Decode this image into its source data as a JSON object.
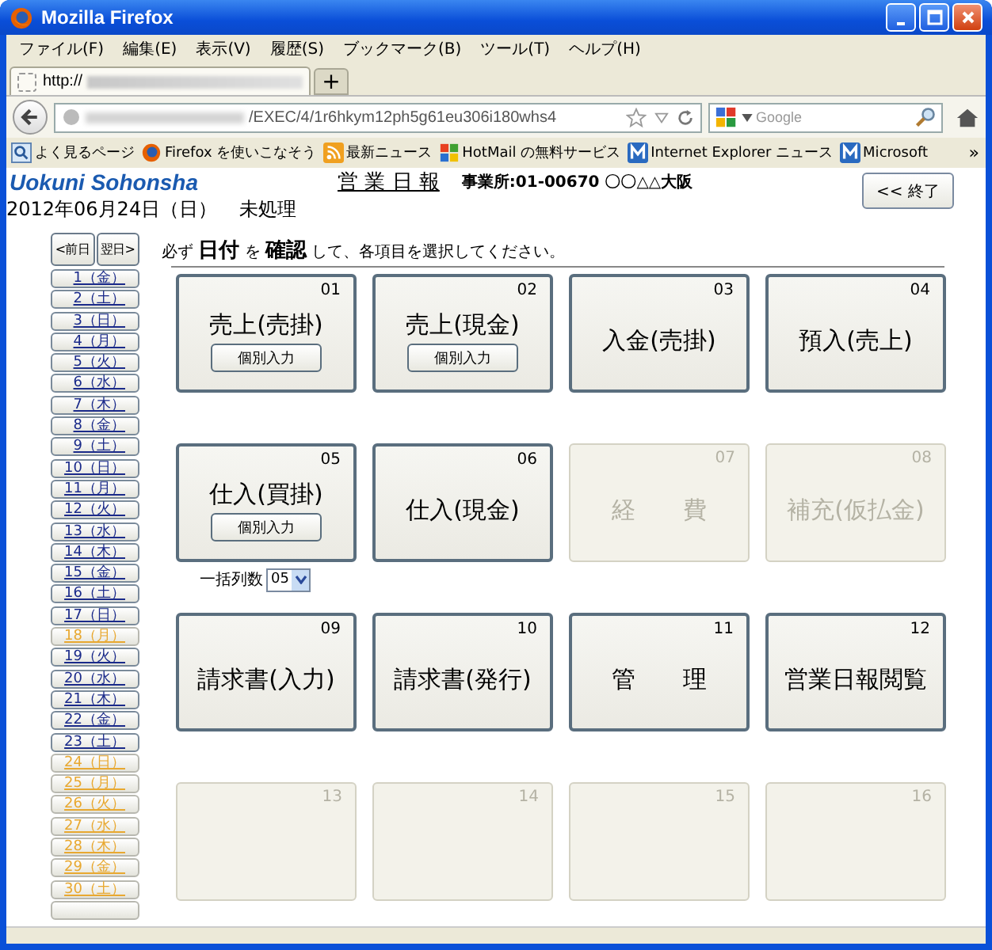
{
  "window": {
    "title": "Mozilla Firefox"
  },
  "menu": [
    "ファイル(F)",
    "編集(E)",
    "表示(V)",
    "履歴(S)",
    "ブックマーク(B)",
    "ツール(T)",
    "ヘルプ(H)"
  ],
  "tabs": [
    {
      "label": "http://",
      "selected": true
    }
  ],
  "new_tab": "+",
  "address_bar": {
    "url": "/EXEC/4/1r6hkym12ph5g61eu306i180whs4"
  },
  "search": {
    "placeholder": "Google"
  },
  "bookmarks": [
    {
      "label": "よく見るページ",
      "kind": "magnifier"
    },
    {
      "label": "Firefox を使いこなそう",
      "kind": "firefox"
    },
    {
      "label": "最新ニュース",
      "kind": "rss"
    },
    {
      "label": "HotMail の無料サービス",
      "kind": "windows"
    },
    {
      "label": "Internet Explorer ニュース",
      "kind": "msn"
    },
    {
      "label": "Microsoft",
      "kind": "msn"
    }
  ],
  "bookmarks_more": "»",
  "page": {
    "brand": "Uokuni Sohonsha",
    "title": "営 業 日 報",
    "office": "事業所:01-00670 〇〇△△大阪",
    "exit_button": "<< 終了",
    "date": "2012年06月24日（日）",
    "status": "未処理",
    "prev_day": "<前日",
    "next_day": "翌日>",
    "instruction": "必ず **日付** を **確認** して、各項目を選択してください。"
  },
  "days": [
    {
      "label": "1（金）",
      "disabled": false
    },
    {
      "label": "2（土）",
      "disabled": false
    },
    {
      "label": "3（日）",
      "disabled": false
    },
    {
      "label": "4（月）",
      "disabled": false
    },
    {
      "label": "5（火）",
      "disabled": false
    },
    {
      "label": "6（水）",
      "disabled": false
    },
    {
      "label": "7（木）",
      "disabled": false
    },
    {
      "label": "8（金）",
      "disabled": false
    },
    {
      "label": "9（土）",
      "disabled": false
    },
    {
      "label": "10（日）",
      "disabled": false
    },
    {
      "label": "11（月）",
      "disabled": false
    },
    {
      "label": "12（火）",
      "disabled": false
    },
    {
      "label": "13（水）",
      "disabled": false
    },
    {
      "label": "14（木）",
      "disabled": false
    },
    {
      "label": "15（金）",
      "disabled": false
    },
    {
      "label": "16（土）",
      "disabled": false
    },
    {
      "label": "17（日）",
      "disabled": false
    },
    {
      "label": "18（月）",
      "disabled": true
    },
    {
      "label": "19（火）",
      "disabled": false
    },
    {
      "label": "20（水）",
      "disabled": false
    },
    {
      "label": "21（木）",
      "disabled": false
    },
    {
      "label": "22（金）",
      "disabled": false
    },
    {
      "label": "23（土）",
      "disabled": false
    },
    {
      "label": "24（日）",
      "disabled": true
    },
    {
      "label": "25（月）",
      "disabled": true
    },
    {
      "label": "26（火）",
      "disabled": true
    },
    {
      "label": "27（水）",
      "disabled": true
    },
    {
      "label": "28（木）",
      "disabled": true
    },
    {
      "label": "29（金）",
      "disabled": true
    },
    {
      "label": "30（土）",
      "disabled": true
    }
  ],
  "tiles": [
    {
      "number": "01",
      "label": "売上(売掛)",
      "disabled": false,
      "sub_button": "個別入力"
    },
    {
      "number": "02",
      "label": "売上(現金)",
      "disabled": false,
      "sub_button": "個別入力"
    },
    {
      "number": "03",
      "label": "入金(売掛)",
      "disabled": false
    },
    {
      "number": "04",
      "label": "預入(売上)",
      "disabled": false
    },
    {
      "number": "05",
      "label": "仕入(買掛)",
      "disabled": false,
      "sub_button": "個別入力"
    },
    {
      "number": "06",
      "label": "仕入(現金)",
      "disabled": false
    },
    {
      "number": "07",
      "label": "経　　費",
      "disabled": true
    },
    {
      "number": "08",
      "label": "補充(仮払金)",
      "disabled": true
    },
    {
      "number": "09",
      "label": "請求書(入力)",
      "disabled": false
    },
    {
      "number": "10",
      "label": "請求書(発行)",
      "disabled": false
    },
    {
      "number": "11",
      "label": "管　　理",
      "disabled": false
    },
    {
      "number": "12",
      "label": "営業日報閲覧",
      "disabled": false
    },
    {
      "number": "13",
      "disabled": true
    },
    {
      "number": "14",
      "disabled": true
    },
    {
      "number": "15",
      "disabled": true
    },
    {
      "number": "16",
      "disabled": true
    }
  ],
  "batch": {
    "label": "一括列数",
    "value": "05"
  }
}
